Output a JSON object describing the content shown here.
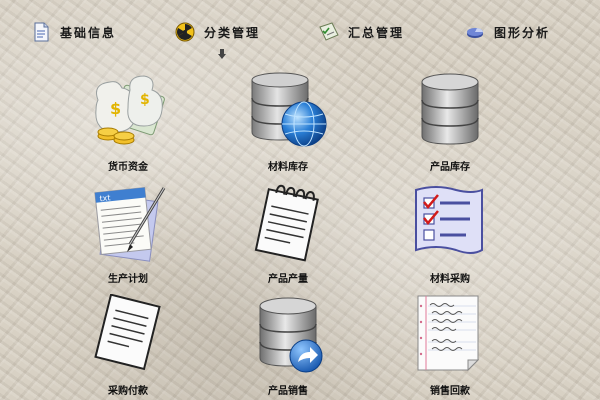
{
  "menu": {
    "items": [
      {
        "label": "基础信息",
        "icon": "document-icon"
      },
      {
        "label": "分类管理",
        "icon": "radiation-icon"
      },
      {
        "label": "汇总管理",
        "icon": "checklist-icon"
      },
      {
        "label": "图形分析",
        "icon": "pie-chart-icon"
      }
    ]
  },
  "tiles": [
    {
      "label": "货币资金",
      "icon": "money-bags-icon"
    },
    {
      "label": "材料库存",
      "icon": "database-globe-icon"
    },
    {
      "label": "产品库存",
      "icon": "database-icon"
    },
    {
      "label": "生产计划",
      "icon": "text-document-pen-icon"
    },
    {
      "label": "产品产量",
      "icon": "notepad-icon"
    },
    {
      "label": "材料采购",
      "icon": "checklist-icon"
    },
    {
      "label": "采购付款",
      "icon": "paper-document-icon"
    },
    {
      "label": "产品销售",
      "icon": "database-arrow-icon"
    },
    {
      "label": "销售回款",
      "icon": "handwritten-note-icon"
    }
  ],
  "colors": {
    "label_text": "#111111",
    "background": "#d8d1c4",
    "globe_blue": "#2a7fd6"
  }
}
